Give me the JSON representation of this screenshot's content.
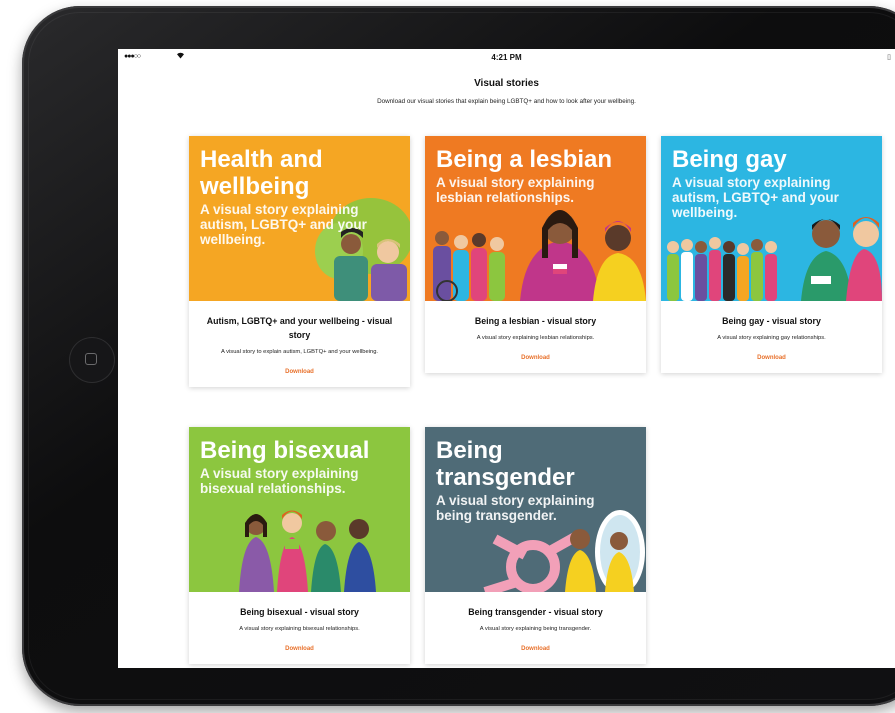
{
  "status_bar": {
    "signal": "●●●○○",
    "time": "4:21 PM"
  },
  "page": {
    "title": "Visual stories",
    "subtitle": "Download our visual stories that explain being LGBTQ+ and how to look after your wellbeing."
  },
  "colors": {
    "accent_download": "#e8702a",
    "health": "#f5a623",
    "lesbian": "#ef7a22",
    "gay": "#2cb6e2",
    "bisexual": "#8cc63f",
    "transgender": "#4f6b77"
  },
  "cards": [
    {
      "banner_title": "Health and wellbeing",
      "banner_subtitle": "A visual story explaining autism, LGBTQ+ and your wellbeing.",
      "title": "Autism, LGBTQ+ and your wellbeing - visual story",
      "description": "A visual story to explain autism, LGBTQ+ and your wellbeing.",
      "download": "Download"
    },
    {
      "banner_title": "Being a lesbian",
      "banner_subtitle": "A visual story explaining lesbian relationships.",
      "title": "Being a lesbian - visual story",
      "description": "A visual story explaining lesbian relationships.",
      "download": "Download"
    },
    {
      "banner_title": "Being gay",
      "banner_subtitle": "A visual story explaining autism, LGBTQ+ and your wellbeing.",
      "title": "Being gay - visual story",
      "description": "A visual story explaining gay relationships.",
      "download": "Download"
    },
    {
      "banner_title": "Being bisexual",
      "banner_subtitle": "A visual story explaining bisexual relationships.",
      "title": "Being bisexual - visual story",
      "description": "A visual story explaining bisexual relationships.",
      "download": "Download"
    },
    {
      "banner_title": "Being transgender",
      "banner_subtitle": "A visual story explaining being transgender.",
      "title": "Being transgender - visual story",
      "description": "A visual story explaining being transgender.",
      "download": "Download"
    }
  ]
}
